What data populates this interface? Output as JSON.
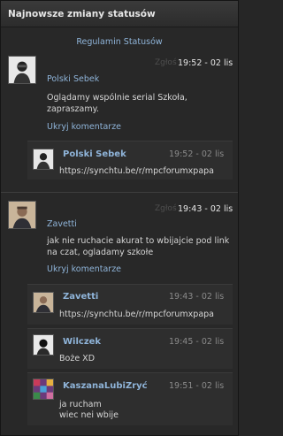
{
  "header": {
    "title": "Najnowsze zmiany statusów"
  },
  "rules_link": "Regulamin Statusów",
  "report_label": "Zgłoś",
  "statuses": [
    {
      "author": "Polski Sebek",
      "time": "19:52 - 02 lis",
      "text_lines": [
        "Oglądamy wspólnie serial Szkoła,",
        "zapraszamy."
      ],
      "hide_label": "Ukryj komentarze",
      "comments": [
        {
          "author": "Polski Sebek",
          "time": "19:52 - 02 lis",
          "text_lines": [
            "https://synchtu.be/r/mpcforumxpapa"
          ]
        }
      ]
    },
    {
      "author": "Zavetti",
      "time": "19:43 - 02 lis",
      "text_lines": [
        "jak nie ruchacie akurat to wbijajcie pod link",
        "na czat, ogladamy szkołe"
      ],
      "hide_label": "Ukryj komentarze",
      "comments": [
        {
          "author": "Zavetti",
          "time": "19:43 - 02 lis",
          "text_lines": [
            "https://synchtu.be/r/mpcforumxpapa"
          ]
        },
        {
          "author": "Wilczek",
          "time": "19:45 - 02 lis",
          "text_lines": [
            "Boże XD"
          ]
        },
        {
          "author": "KaszanaLubiZryć",
          "time": "19:51 - 02 lis",
          "text_lines": [
            "ja rucham",
            "wiec nei wbije"
          ]
        }
      ]
    }
  ]
}
